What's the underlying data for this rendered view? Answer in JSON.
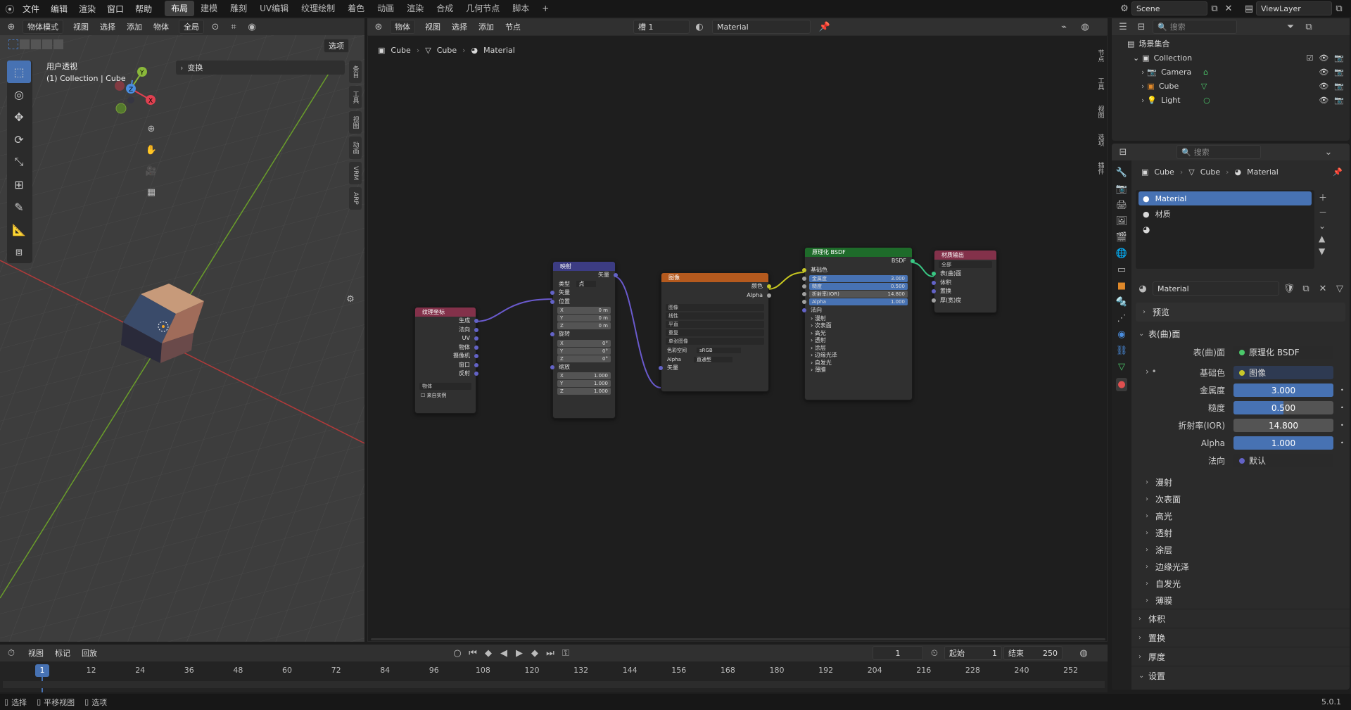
{
  "topbar": {
    "menus": [
      "文件",
      "编辑",
      "渲染",
      "窗口",
      "帮助"
    ],
    "workspaces": [
      "布局",
      "建模",
      "雕刻",
      "UV编辑",
      "纹理绘制",
      "着色",
      "动画",
      "渲染",
      "合成",
      "几何节点",
      "脚本"
    ],
    "active_workspace": "布局",
    "add_tab": "+",
    "scene": "Scene",
    "view_layer": "ViewLayer"
  },
  "viewport": {
    "mode": "物体模式",
    "menus": [
      "视图",
      "选择",
      "添加",
      "物体"
    ],
    "orientation": "全局",
    "options": "选项",
    "title": "用户透视",
    "collection": "(1) Collection | Cube",
    "transform_panel": "变换",
    "side_tabs": [
      "条目",
      "工具",
      "视图",
      "动画",
      "VRM",
      "ARP"
    ],
    "gizmo": {
      "x": "X",
      "y": "Y",
      "z": "Z"
    }
  },
  "node_editor": {
    "type": "物体",
    "menus": [
      "视图",
      "选择",
      "添加",
      "节点"
    ],
    "slot": "槽 1",
    "material": "Material",
    "breadcrumb": [
      "Cube",
      "Cube",
      "Material"
    ],
    "side_tabs": [
      "节点",
      "工具",
      "视图",
      "选项",
      "插件"
    ],
    "nodes": {
      "texcoord": {
        "title": "纹理坐标",
        "outputs": [
          "生成",
          "法向",
          "UV",
          "物体",
          "摄像机",
          "窗口",
          "反射"
        ],
        "object_placeholder": "物体",
        "from_instancer": "来自实例"
      },
      "mapping": {
        "title": "映射",
        "out": "矢量",
        "type_label": "类型",
        "type_value": "点",
        "in_vector": "矢量",
        "loc": "位置",
        "rot": "旋转",
        "scale": "缩放",
        "loc_vals": [
          [
            "X",
            "0 m"
          ],
          [
            "Y",
            "0 m"
          ],
          [
            "Z",
            "0 m"
          ]
        ],
        "rot_vals": [
          [
            "X",
            "0°"
          ],
          [
            "Y",
            "0°"
          ],
          [
            "Z",
            "0°"
          ]
        ],
        "scale_vals": [
          [
            "X",
            "1.000"
          ],
          [
            "Y",
            "1.000"
          ],
          [
            "Z",
            "1.000"
          ]
        ]
      },
      "image": {
        "title": "图像",
        "out_color": "颜色",
        "out_alpha": "Alpha",
        "image_name": "图像",
        "interp": "线性",
        "proj": "平直",
        "ext": "重复",
        "source": "单张图像",
        "cs_label": "色彩空间",
        "cs": "sRGB",
        "alpha_label": "Alpha",
        "alpha": "直通型",
        "in_vector": "矢量"
      },
      "bsdf": {
        "title": "原理化 BSDF",
        "out": "BSDF",
        "base": "基础色",
        "fields": [
          [
            "金属度",
            "3.000"
          ],
          [
            "糙度",
            "0.500"
          ],
          [
            "折射率(IOR)",
            "14.800"
          ],
          [
            "Alpha",
            "1.000"
          ]
        ],
        "normal": "法向",
        "subs": [
          "漫射",
          "次表面",
          "高光",
          "透射",
          "涂层",
          "边缘光泽",
          "自发光",
          "薄膜"
        ]
      },
      "output": {
        "title": "材质输出",
        "target": "全部",
        "inputs": [
          "表(曲)面",
          "体积",
          "置换",
          "厚(宽)度"
        ]
      }
    }
  },
  "outliner": {
    "search_placeholder": "搜索",
    "root": "场景集合",
    "collection": "Collection",
    "items": [
      "Camera",
      "Cube",
      "Light"
    ]
  },
  "properties": {
    "search_placeholder": "搜索",
    "breadcrumb": [
      "Cube",
      "Cube",
      "Material"
    ],
    "slots": [
      "Material",
      "材质"
    ],
    "material_name": "Material",
    "preview": "预览",
    "surface": "表(曲)面",
    "surface_label": "表(曲)面",
    "surface_value": "原理化 BSDF",
    "base_color_label": "基础色",
    "base_color_value": "图像",
    "fields": [
      {
        "label": "金属度",
        "value": "3.000",
        "fill": 1.0
      },
      {
        "label": "糙度",
        "value": "0.500",
        "fill": 0.5
      },
      {
        "label": "折射率(IOR)",
        "value": "14.800",
        "fill": 0
      },
      {
        "label": "Alpha",
        "value": "1.000",
        "fill": 1.0
      }
    ],
    "normal_label": "法向",
    "normal_value": "默认",
    "subsections": [
      "漫射",
      "次表面",
      "高光",
      "透射",
      "涂层",
      "边缘光泽",
      "自发光",
      "薄膜"
    ],
    "sections": [
      "体积",
      "置换",
      "厚度",
      "设置"
    ]
  },
  "timeline": {
    "menus": [
      "视图",
      "标记",
      "回放"
    ],
    "current_frame": "1",
    "start_label": "起始",
    "start": "1",
    "end_label": "结束",
    "end": "250",
    "ticks": [
      "12",
      "24",
      "36",
      "48",
      "60",
      "72",
      "84",
      "96",
      "108",
      "120",
      "132",
      "144",
      "156",
      "168",
      "180",
      "192",
      "204",
      "216",
      "228",
      "240",
      "252"
    ],
    "marker": "1"
  },
  "statusbar": {
    "items": [
      "选择",
      "平移视图",
      "选项"
    ],
    "version": "5.0.1"
  }
}
